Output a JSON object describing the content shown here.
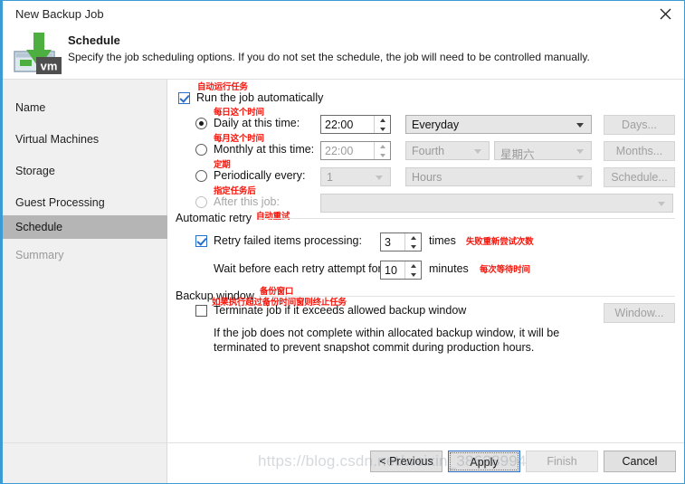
{
  "window": {
    "title": "New Backup Job",
    "close_icon": "close-icon"
  },
  "header": {
    "icon": "veeam-vm-backup-icon",
    "title": "Schedule",
    "description": "Specify the job scheduling options. If you do not set the schedule, the job will need to be controlled manually."
  },
  "sidebar": {
    "items": [
      {
        "label": "Name",
        "state": "normal"
      },
      {
        "label": "Virtual Machines",
        "state": "normal"
      },
      {
        "label": "Storage",
        "state": "normal"
      },
      {
        "label": "Guest Processing",
        "state": "normal"
      },
      {
        "label": "Schedule",
        "state": "active"
      },
      {
        "label": "Summary",
        "state": "disabled"
      }
    ]
  },
  "schedule": {
    "run_automatically": {
      "label": "Run the job automatically",
      "checked": true,
      "annotation": "自动运行任务"
    },
    "options": [
      {
        "label": "Daily at this time:",
        "selected": true,
        "annotation": "每日这个时间",
        "time_value": "22:00",
        "combo1": "Everyday",
        "combo2": null,
        "side_button": "Days..."
      },
      {
        "label": "Monthly at this time:",
        "selected": false,
        "annotation": "每月这个时间",
        "time_value": "22:00",
        "combo1": "Fourth",
        "combo2": "星期六",
        "side_button": "Months..."
      },
      {
        "label": "Periodically every:",
        "selected": false,
        "annotation": "定期",
        "time_value": "1",
        "combo1": "Hours",
        "combo2": null,
        "side_button": "Schedule..."
      },
      {
        "label": "After this job:",
        "selected": false,
        "disabled": true,
        "annotation": "指定任务后",
        "time_value": "",
        "combo1": "",
        "combo2": null,
        "side_button": ""
      }
    ]
  },
  "automatic_retry": {
    "group_label": "Automatic retry",
    "group_annotation": "自动重试",
    "retry_failed": {
      "label": "Retry failed items processing:",
      "checked": true,
      "value": "3",
      "unit": "times",
      "annotation": "失败重新尝试次数"
    },
    "wait_before": {
      "label": "Wait before each retry attempt for:",
      "value": "10",
      "unit": "minutes",
      "annotation": "每次等待时间"
    }
  },
  "backup_window": {
    "group_label": "Backup window",
    "group_annotation": "备份窗口",
    "terminate": {
      "label": "Terminate job if it exceeds allowed backup window",
      "checked": false,
      "annotation": "如果执行超过备份时间窗则终止任务"
    },
    "description_line1": "If the job does not complete within allocated backup window, it will be",
    "description_line2": "terminated to prevent snapshot commit during production hours.",
    "window_button": "Window..."
  },
  "footer": {
    "previous": "< Previous",
    "apply": "Apply",
    "finish": "Finish",
    "cancel": "Cancel"
  },
  "watermark": "https://blog.csdn.net/weixin_38628994",
  "colors": {
    "accent": "#2a6fc9",
    "window_border": "#3a9bd5",
    "annotation_red": "#f5160c",
    "sidebar_bg": "#f0f0f0",
    "active_nav": "#b5b5b5",
    "icon_green": "#4caf3f"
  }
}
